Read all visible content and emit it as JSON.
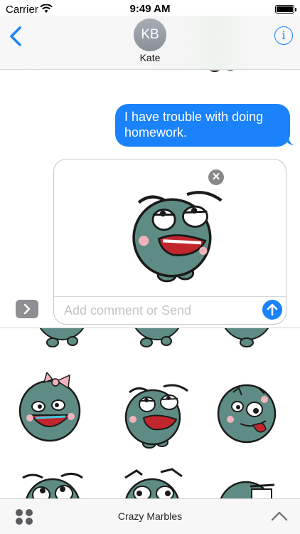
{
  "status_bar": {
    "carrier": "Carrier",
    "time": "9:49 AM",
    "battery_level": 1.0
  },
  "header": {
    "avatar_initials": "KB",
    "contact_name": "Kate",
    "back_icon": "chevron-left-icon",
    "info_icon_glyph": "i"
  },
  "conversation": {
    "messages": [
      {
        "from": "me",
        "text": "I have trouble with doing homework."
      }
    ]
  },
  "compose": {
    "placeholder": "Add comment or Send",
    "value": "",
    "remove_glyph": "✕",
    "sticker": "rolling-eyes-marble-sticker"
  },
  "sticker_browser": {
    "stickers": [
      "smiling-marble-sticker",
      "blushing-marble-sticker",
      "grumpy-marble-sticker",
      "laughing-bow-marble-sticker",
      "rolling-eyes-marble-sticker",
      "tongue-out-marble-sticker",
      "wide-eyed-marble-sticker",
      "surprised-marble-sticker",
      "squinting-marble-sticker"
    ]
  },
  "bottom_bar": {
    "app_name": "Crazy Marbles"
  },
  "colors": {
    "accent": "#1a82fb",
    "marble": "#5e8c84",
    "marble_dark": "#3f6c64",
    "mouth_red": "#c0262c",
    "cheek_pink": "#f1b3bb"
  }
}
